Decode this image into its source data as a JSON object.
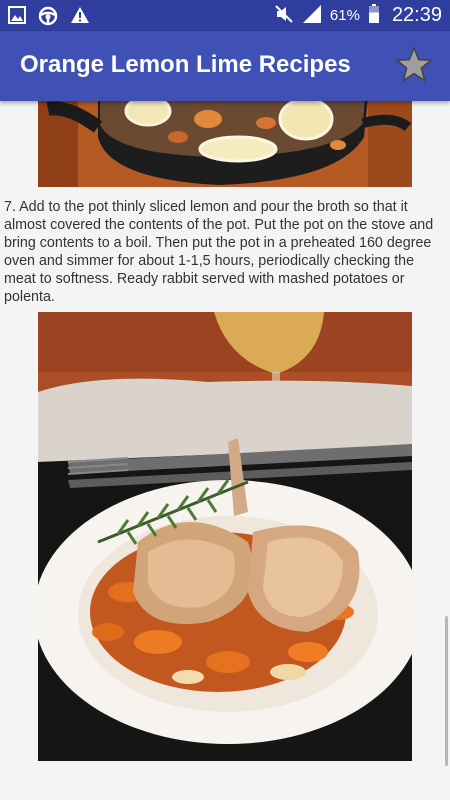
{
  "status_bar": {
    "notification_icons": [
      "gallery-icon",
      "steering-wheel-icon",
      "warning-icon"
    ],
    "status_icons": [
      "mute-icon",
      "signal-icon",
      "battery-icon"
    ],
    "battery_level": "61%",
    "time": "22:39"
  },
  "app_bar": {
    "title": "Orange Lemon Lime Recipes",
    "favorite_icon": "star-icon",
    "color": "#3f51b5",
    "status_color": "#303f9f"
  },
  "recipe": {
    "step_7": "7. Add to the pot thinly sliced lemon and pour the broth so that it almost covered the contents of the pot. Put the pot on the stove and bring contents to a boil. Then put the pot in a preheated 160 degree oven and simmer for about 1-1,5 hours, periodically checking the meat to softness. Ready rabbit served with mashed potatoes or polenta."
  }
}
